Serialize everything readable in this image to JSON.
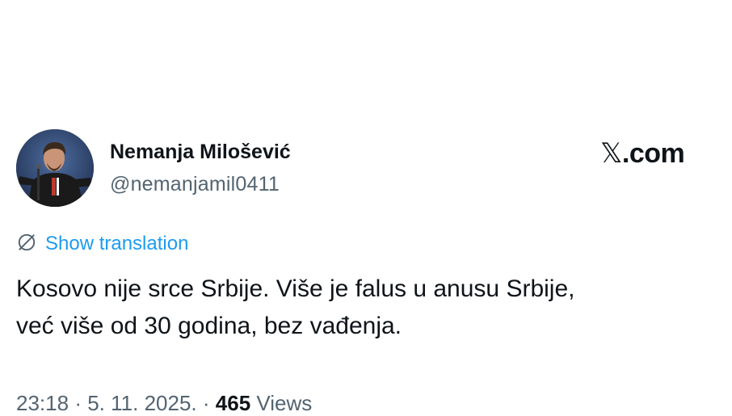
{
  "author": {
    "name": "Nemanja Milošević",
    "handle": "@nemanjamil0411"
  },
  "source": {
    "site_mark": "𝕏",
    "site_suffix": ".com"
  },
  "translate": {
    "label": "Show translation",
    "icon": "globe-icon"
  },
  "tweet": {
    "lines": [
      "Kosovo nije srce Srbije. Više je falus u anusu Srbije,",
      "već više od 30 godina, bez vađenja."
    ]
  },
  "meta": {
    "time": "23:18",
    "separator": "·",
    "date": "5. 11. 2025.",
    "views_count": "465",
    "views_label": "Views"
  },
  "colors": {
    "accent": "#1d9bf0",
    "text": "#0f1419",
    "muted": "#536471"
  }
}
